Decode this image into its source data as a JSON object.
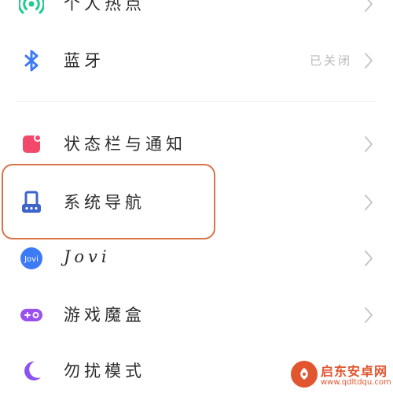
{
  "settings": {
    "items": [
      {
        "label": "个人热点",
        "icon": "hotspot-icon",
        "value": ""
      },
      {
        "label": "蓝牙",
        "icon": "bluetooth-icon",
        "value": "已关闭"
      },
      {
        "label": "状态栏与通知",
        "icon": "status-bar-icon",
        "value": ""
      },
      {
        "label": "系统导航",
        "icon": "system-navigation-icon",
        "value": ""
      },
      {
        "label": "Jovi",
        "icon": "jovi-icon",
        "value": "",
        "icon_text": "Jovi"
      },
      {
        "label": "游戏魔盒",
        "icon": "game-box-icon",
        "value": ""
      },
      {
        "label": "勿扰模式",
        "icon": "moon-icon",
        "value": ""
      }
    ]
  },
  "watermark": {
    "title": "启东安卓网",
    "url": "www.qdltdqu.com"
  },
  "colors": {
    "hotspot": "#1ecb8c",
    "bluetooth": "#3d7af6",
    "status_bar": "#f2486a",
    "navigation": "#3d64c8",
    "jovi": "#3d7af6",
    "game_box": "#9a50f0",
    "dnd": "#8a52f0",
    "highlight_border": "#d9744a",
    "watermark": "#e1552f"
  }
}
